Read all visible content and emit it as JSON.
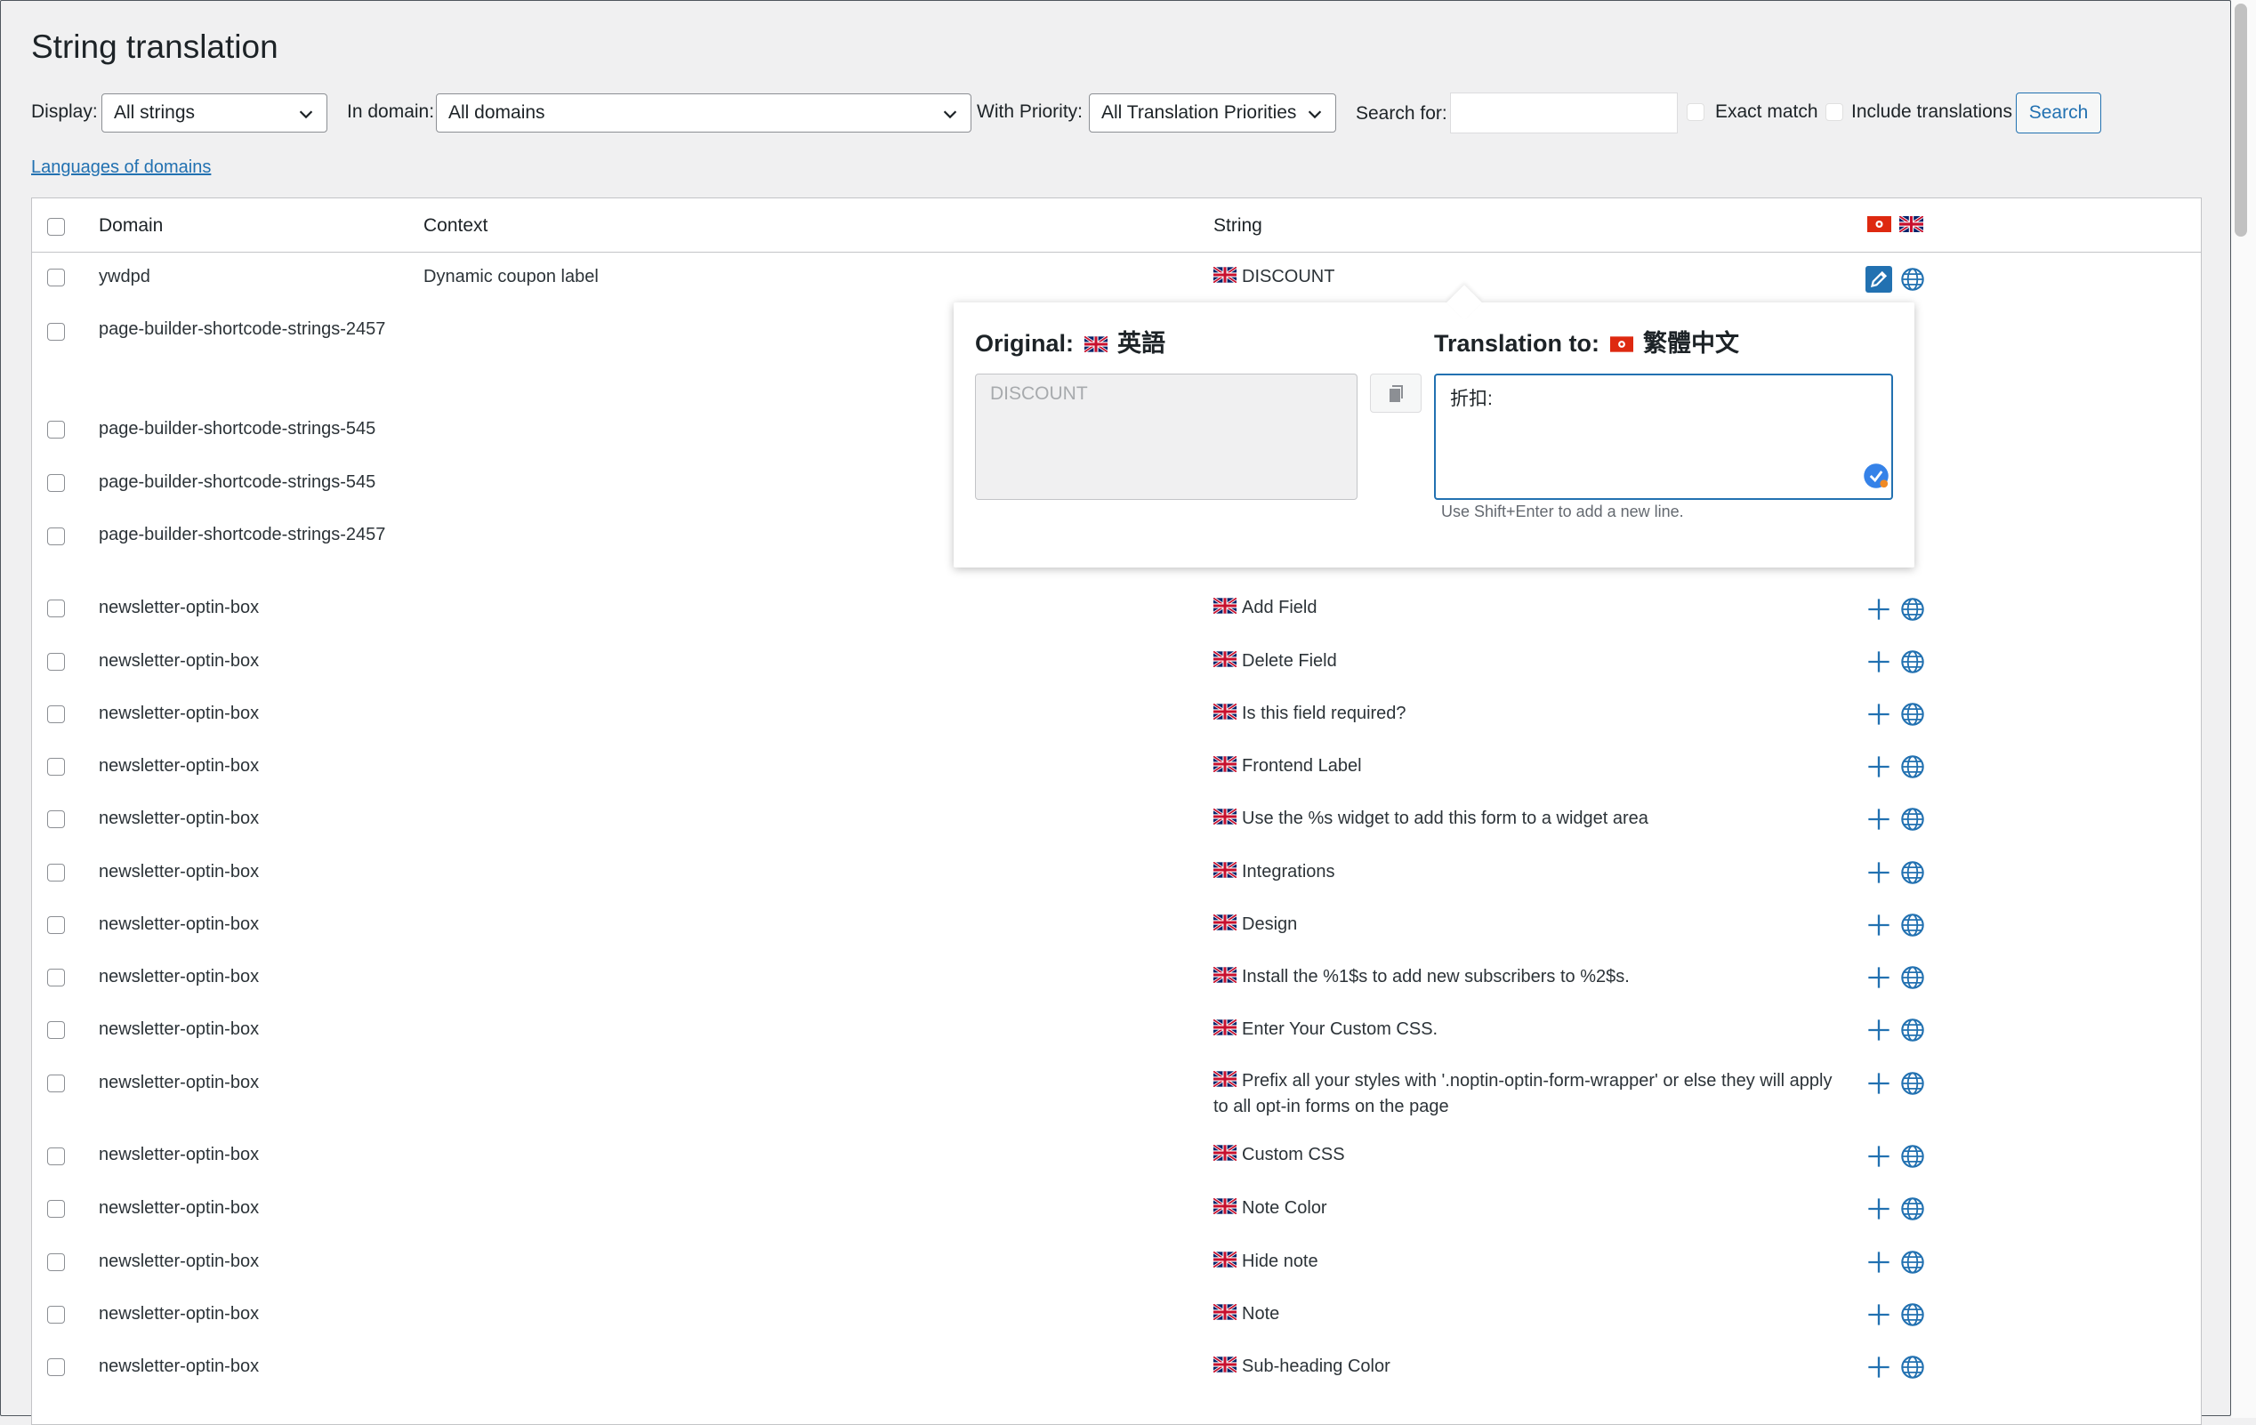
{
  "page": {
    "title": "String translation"
  },
  "filters": {
    "display_label": "Display:",
    "display_value": "All strings",
    "domain_label": "In domain:",
    "domain_value": "All domains",
    "priority_label": "With Priority:",
    "priority_value": "All Translation Priorities",
    "search_label": "Search for:",
    "search_value": "",
    "exact_match_label": "Exact match",
    "include_translations_label": "Include translations",
    "search_button": "Search",
    "languages_link": "Languages of domains"
  },
  "table": {
    "headers": {
      "domain": "Domain",
      "context": "Context",
      "string": "String"
    },
    "rows": [
      {
        "domain": "ywdpd",
        "context": "Dynamic coupon label",
        "string": "DISCOUNT"
      },
      {
        "domain": "page-builder-shortcode-strings-2457",
        "context": "",
        "string": ""
      },
      {
        "domain": "page-builder-shortcode-strings-545",
        "context": "",
        "string": ""
      },
      {
        "domain": "page-builder-shortcode-strings-545",
        "context": "",
        "string": ""
      },
      {
        "domain": "page-builder-shortcode-strings-2457",
        "context": "",
        "string": ""
      },
      {
        "domain": "newsletter-optin-box",
        "context": "",
        "string": "Add Field"
      },
      {
        "domain": "newsletter-optin-box",
        "context": "",
        "string": "Delete Field"
      },
      {
        "domain": "newsletter-optin-box",
        "context": "",
        "string": "Is this field required?"
      },
      {
        "domain": "newsletter-optin-box",
        "context": "",
        "string": "Frontend Label"
      },
      {
        "domain": "newsletter-optin-box",
        "context": "",
        "string": "Use the %s widget to add this form to a widget area"
      },
      {
        "domain": "newsletter-optin-box",
        "context": "",
        "string": "Integrations"
      },
      {
        "domain": "newsletter-optin-box",
        "context": "",
        "string": "Design"
      },
      {
        "domain": "newsletter-optin-box",
        "context": "",
        "string": "Install the %1$s to add new subscribers to %2$s."
      },
      {
        "domain": "newsletter-optin-box",
        "context": "",
        "string": "Enter Your Custom CSS."
      },
      {
        "domain": "newsletter-optin-box",
        "context": "",
        "string": "Prefix all your styles with '.noptin-optin-form-wrapper' or else they will apply to all opt-in forms on the page"
      },
      {
        "domain": "newsletter-optin-box",
        "context": "",
        "string": "Custom CSS"
      },
      {
        "domain": "newsletter-optin-box",
        "context": "",
        "string": "Note Color"
      },
      {
        "domain": "newsletter-optin-box",
        "context": "",
        "string": "Hide note"
      },
      {
        "domain": "newsletter-optin-box",
        "context": "",
        "string": "Note"
      },
      {
        "domain": "newsletter-optin-box",
        "context": "",
        "string": "Sub-heading Color"
      }
    ]
  },
  "popup": {
    "original_label": "Original:",
    "original_lang": "英語",
    "original_text": "DISCOUNT",
    "translation_label": "Translation to:",
    "translation_lang": "繁體中文",
    "translation_value": "折扣:",
    "hint": "Use Shift+Enter to add a new line."
  },
  "colors": {
    "accent": "#2271b1",
    "background": "#f0f0f1"
  },
  "icons": [
    "chevron-down-icon",
    "uk-flag-icon",
    "hk-flag-icon",
    "pencil-icon",
    "globe-icon",
    "plus-icon",
    "copy-icon",
    "checkmark-icon"
  ]
}
